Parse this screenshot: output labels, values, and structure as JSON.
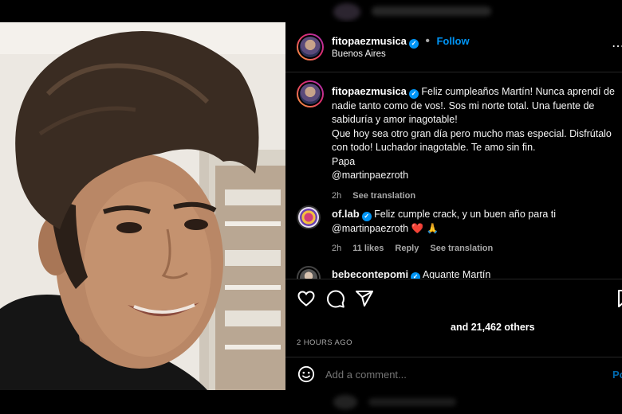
{
  "post": {
    "username": "fitopaezmusica",
    "follow_label": "Follow",
    "location": "Buenos Aires",
    "caption_lines": [
      "Feliz cumpleaños Martín! Nunca aprendí de",
      "nadie tanto como de vos!. Sos mi norte total. Una fuente de",
      "sabiduría y amor inagotable!",
      "Que hoy sea otro gran día pero mucho mas especial. Disfrútalo",
      "con todo! Luchador inagotable. Te amo sin fin.",
      "Papa",
      "@martinpaezroth"
    ],
    "caption_time": "2h",
    "see_translation": "See translation"
  },
  "comments": [
    {
      "username": "of.lab",
      "text_line1": "Feliz cumple crack, y un buen año para ti",
      "text_line2": "@martinpaezroth ❤️ 🙏",
      "time": "2h",
      "likes": "11 likes",
      "reply": "Reply",
      "see_translation": "See translation"
    },
    {
      "username": "bebecontepomi",
      "text": "Aguante Martín"
    }
  ],
  "likes_text": {
    "prefix": "and",
    "count": "21,462 others"
  },
  "timestamp": "2 HOURS AGO",
  "add_comment": {
    "placeholder": "Add a comment...",
    "post_label": "Post"
  },
  "colors": {
    "accent": "#0095f6",
    "background": "#000000",
    "muted_text": "#a8a8a8"
  },
  "icons": [
    "like-icon",
    "comment-icon",
    "share-icon",
    "save-icon",
    "emoji-icon",
    "more-options-icon",
    "verified-icon"
  ]
}
